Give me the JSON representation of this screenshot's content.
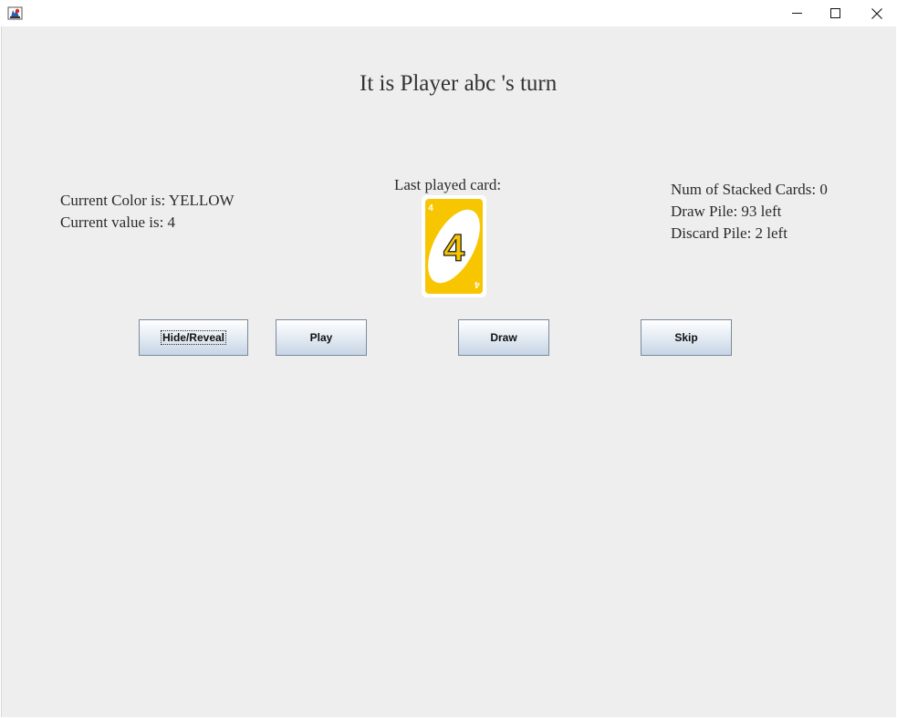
{
  "window": {
    "app_icon": "java-cup-icon",
    "controls": {
      "minimize": "—",
      "maximize": "☐",
      "close": "✕"
    }
  },
  "game": {
    "turn_title": "It is Player abc 's turn",
    "current_color": "Current Color is: YELLOW",
    "current_value": "Current value is: 4",
    "last_played_label": "Last played card:",
    "last_card": {
      "value": "4",
      "color": "#f7c600"
    },
    "stacked_cards": "Num of Stacked Cards: 0",
    "draw_pile": "Draw Pile: 93 left",
    "discard_pile": "Discard Pile: 2 left"
  },
  "buttons": {
    "hide_reveal": "Hide/Reveal",
    "play": "Play",
    "draw": "Draw",
    "skip": "Skip"
  }
}
